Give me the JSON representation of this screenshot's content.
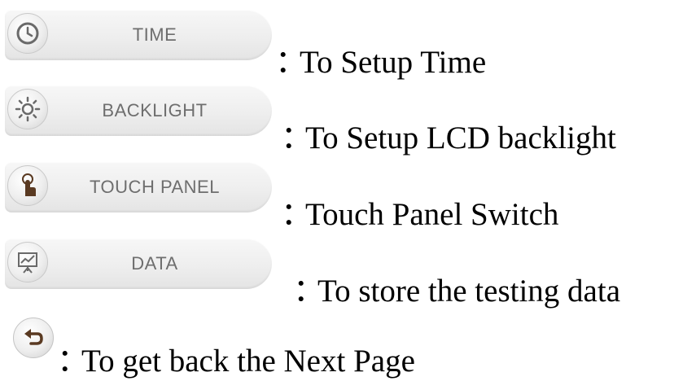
{
  "items": [
    {
      "button_label": "TIME",
      "icon": "clock-icon",
      "description": "To Setup Time"
    },
    {
      "button_label": "BACKLIGHT",
      "icon": "sun-icon",
      "description": "To Setup LCD backlight"
    },
    {
      "button_label": "TOUCH PANEL",
      "icon": "touch-hand-icon",
      "description": "Touch Panel Switch"
    },
    {
      "button_label": "DATA",
      "icon": "chart-board-icon",
      "description": "To store the testing data"
    }
  ],
  "back": {
    "icon": "back-arrow-icon",
    "description": "To get back the Next Page"
  },
  "separator": "：",
  "colors": {
    "button_text": "#6e6e6e",
    "icon_stroke": "#6a6a6a",
    "touch_icon": "#5a3a22",
    "text": "#000000"
  }
}
